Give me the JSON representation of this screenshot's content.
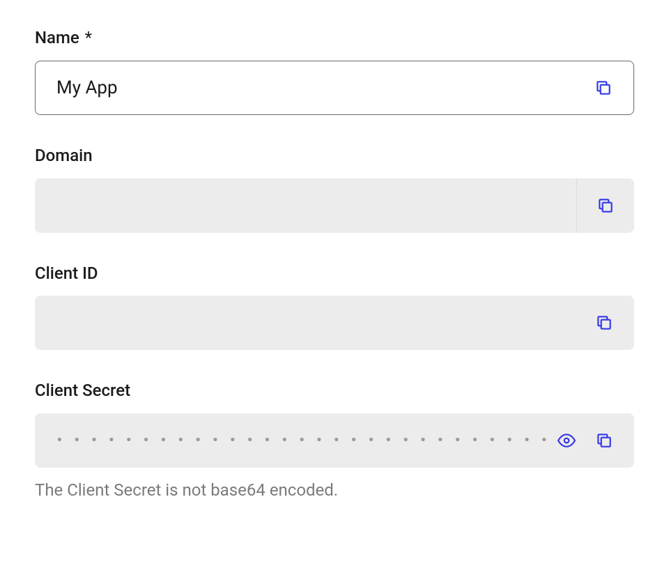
{
  "fields": {
    "name": {
      "label": "Name",
      "required_marker": "*",
      "value": "My App"
    },
    "domain": {
      "label": "Domain",
      "value": ""
    },
    "client_id": {
      "label": "Client ID",
      "value": ""
    },
    "client_secret": {
      "label": "Client Secret",
      "masked_value": "•••••••••••••••••••••••••••••••••••••••",
      "helper": "The Client Secret is not base64 encoded."
    }
  },
  "colors": {
    "accent": "#3538e8",
    "readonly_bg": "#ececec",
    "text": "#1a1a1a",
    "muted": "#7a7a7a"
  }
}
